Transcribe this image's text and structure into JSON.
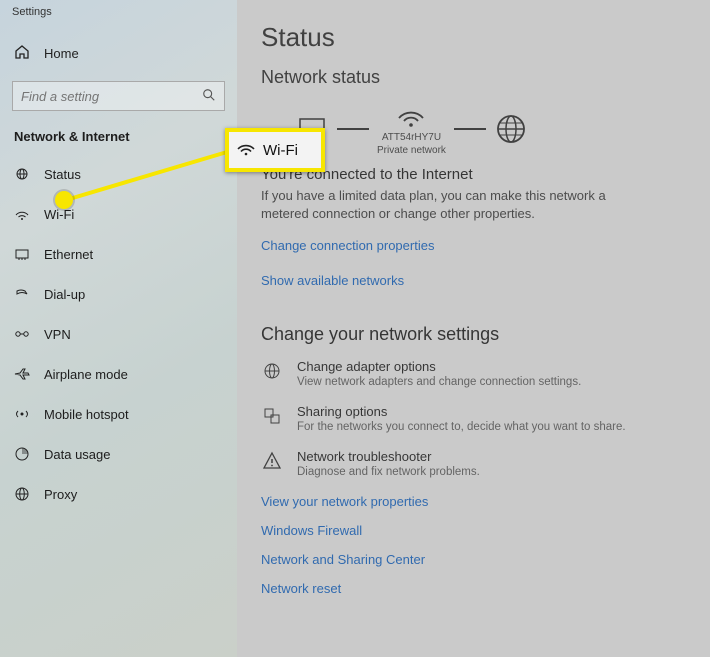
{
  "app_title": "Settings",
  "home_label": "Home",
  "search": {
    "placeholder": "Find a setting"
  },
  "category": "Network & Internet",
  "nav": {
    "status": "Status",
    "wifi": "Wi-Fi",
    "ethernet": "Ethernet",
    "dialup": "Dial-up",
    "vpn": "VPN",
    "airplane": "Airplane mode",
    "hotspot": "Mobile hotspot",
    "datausage": "Data usage",
    "proxy": "Proxy"
  },
  "callout": {
    "label": "Wi-Fi"
  },
  "main": {
    "title": "Status",
    "subtitle": "Network status",
    "diagram": {
      "ssid": "ATT54rHY7U",
      "nettype": "Private network"
    },
    "connected_heading": "You're connected to the Internet",
    "connected_body": "If you have a limited data plan, you can make this network a metered connection or change other properties.",
    "link_change_props": "Change connection properties",
    "link_show_networks": "Show available networks",
    "change_heading": "Change your network settings",
    "opts": {
      "adapter": {
        "title": "Change adapter options",
        "desc": "View network adapters and change connection settings."
      },
      "sharing": {
        "title": "Sharing options",
        "desc": "For the networks you connect to, decide what you want to share."
      },
      "troubleshoot": {
        "title": "Network troubleshooter",
        "desc": "Diagnose and fix network problems."
      }
    },
    "links": {
      "props": "View your network properties",
      "firewall": "Windows Firewall",
      "center": "Network and Sharing Center",
      "reset": "Network reset"
    }
  }
}
